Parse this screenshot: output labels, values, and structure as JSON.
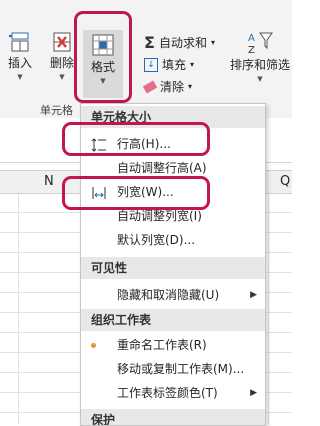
{
  "ribbon": {
    "insert_label": "插入",
    "delete_label": "删除",
    "format_label": "格式",
    "cells_group_label": "单元格",
    "autosum_label": "自动求和",
    "fill_label": "填充",
    "clear_label": "清除",
    "sort_filter_label": "排序和筛选"
  },
  "sheet": {
    "col_n": "N",
    "col_q": "Q"
  },
  "menu": {
    "section_cell_size": "单元格大小",
    "row_height": "行高(H)...",
    "autofit_row_height": "自动调整行高(A)",
    "column_width": "列宽(W)...",
    "autofit_column_width": "自动调整列宽(I)",
    "default_width": "默认列宽(D)...",
    "section_visibility": "可见性",
    "hide_unhide": "隐藏和取消隐藏(U)",
    "section_organize": "组织工作表",
    "rename_sheet": "重命名工作表(R)",
    "move_copy_sheet": "移动或复制工作表(M)...",
    "tab_color": "工作表标签颜色(T)",
    "section_protection": "保护"
  },
  "colors": {
    "highlight_ring": "#c0174d",
    "menu_section_bg": "#e8e8e8",
    "bullet": "#e8923a"
  }
}
